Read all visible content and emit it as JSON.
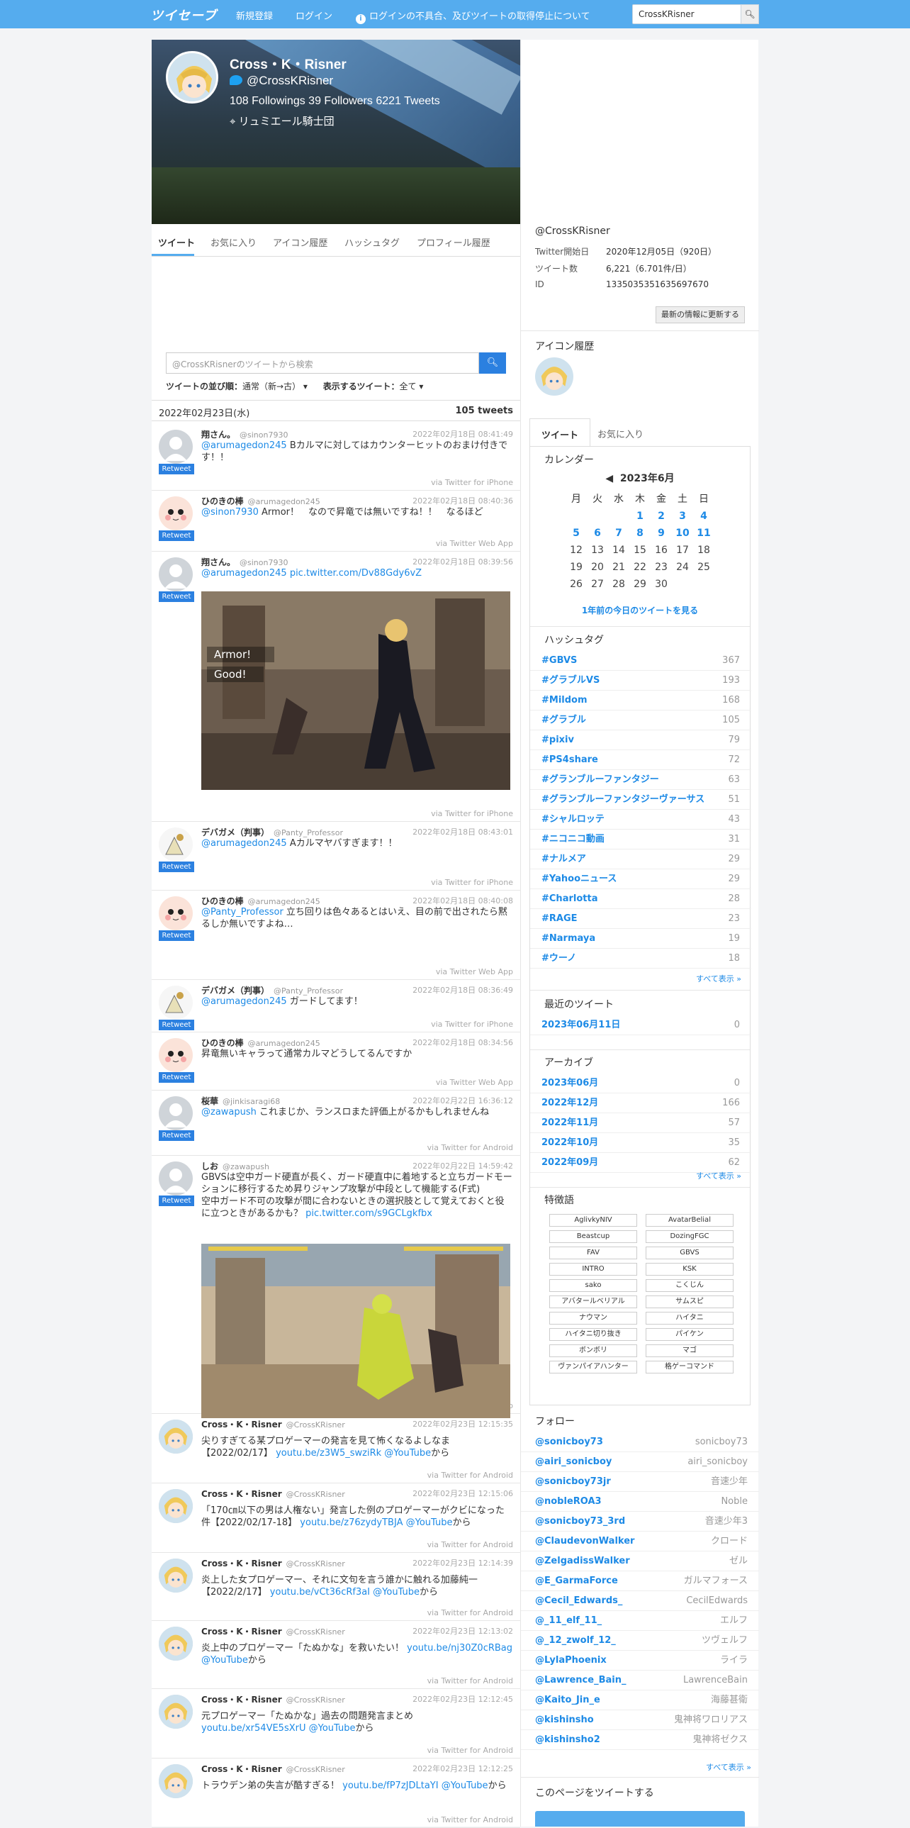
{
  "topbar": {
    "logo": "ツイセーブ",
    "signup": "新規登録",
    "login": "ログイン",
    "notice": "ログインの不具合、及びツイートの取得停止について",
    "search_value": "CrossKRisner"
  },
  "profile": {
    "name": "Cross・K・Risner",
    "handle": "@CrossKRisner",
    "stats": "108 Followings   39 Followers   6221 Tweets",
    "location": "リュミエール騎士団"
  },
  "tabs": [
    "ツイート",
    "お気に入り",
    "アイコン履歴",
    "ハッシュタグ",
    "プロフィール履歴"
  ],
  "tweet_search": {
    "placeholder": "@CrossKRisnerのツイートから検索",
    "sort_label": "ツイートの並び順：",
    "sort_value": "通常（新→古）",
    "show_label": "表示するツイート：",
    "show_value": "全て"
  },
  "date_header": {
    "date": "2022年02月23日(水)",
    "count": "105 tweets"
  },
  "retweet_label": "Retweet",
  "tweets": [
    {
      "name": "翔さん。",
      "screen": "@sinon7930",
      "date": "2022年02月18日 08:41:49",
      "text_link": "@arumagedon245",
      "text": " Bカルマに対してはカウンターヒットのおまけ付きです！！",
      "via": "via Twitter for iPhone"
    },
    {
      "name": "ひのきの棒",
      "screen": "@arumagedon245",
      "date": "2022年02月18日 08:40:36",
      "text_link": "@sinon7930",
      "text": " Armor！　なので昇竜では無いですね！！　なるほど",
      "via": "via Twitter Web App"
    },
    {
      "name": "翔さん。",
      "screen": "@sinon7930",
      "date": "2022年02月18日 08:39:56",
      "text_link": "@arumagedon245 pic.twitter.com/Dv88Gdy6vZ",
      "text": "",
      "via": "via Twitter for iPhone"
    },
    {
      "name": "デバガメ（判事）",
      "screen": "@Panty_Professor",
      "date": "2022年02月18日 08:43:01",
      "text_link": "@arumagedon245",
      "text": " Aカルマヤバすぎます！！",
      "via": "via Twitter for iPhone"
    },
    {
      "name": "ひのきの棒",
      "screen": "@arumagedon245",
      "date": "2022年02月18日 08:40:08",
      "text_link": "@Panty_Professor",
      "text": " 立ち回りは色々あるとはいえ、目の前で出されたら黙るしか無いですよね…",
      "via": "via Twitter Web App"
    },
    {
      "name": "デバガメ（判事）",
      "screen": "@Panty_Professor",
      "date": "2022年02月18日 08:36:49",
      "text_link": "@arumagedon245",
      "text": " ガードしてます！",
      "via": "via Twitter for iPhone"
    },
    {
      "name": "ひのきの棒",
      "screen": "@arumagedon245",
      "date": "2022年02月18日 08:34:56",
      "text_link": "",
      "text": "昇竜無いキャラって通常カルマどうしてるんですか",
      "via": "via Twitter Web App"
    },
    {
      "name": "桜華",
      "screen": "@jinkisaragi68",
      "date": "2022年02月22日 16:36:12",
      "text_link": "@zawapush",
      "text": " これまじか、ランスロまた評価上がるかもしれませんね",
      "via": "via Twitter for Android"
    },
    {
      "name": "しお",
      "screen": "@zawapush",
      "date": "2022年02月22日 14:59:42",
      "text_link": "",
      "text": "GBVSは空中ガード硬直が長く、ガード硬直中に着地すると立ちガードモーションに移行するため昇りジャンプ攻撃が中段として機能する(F式)\n空中ガード不可の攻撃が間に合わないときの選択肢として覚えておくと役に立つときがあるかも？ ",
      "text_tail_link": "pic.twitter.com/s9GCLgkfbx",
      "via": "via Twitter Web App"
    },
    {
      "name": "Cross・K・Risner",
      "screen": "@CrossKRisner",
      "date": "2022年02月23日 12:15:35",
      "text_link": "",
      "text": "尖りすぎてる某プロゲーマーの発言を見て怖くなるよしなま【2022/02/17】 ",
      "text_tail_link": "youtu.be/z3W5_swziRk @YouTube",
      "text_tail": "から",
      "via": "via Twitter for Android"
    },
    {
      "name": "Cross・K・Risner",
      "screen": "@CrossKRisner",
      "date": "2022年02月23日 12:15:06",
      "text_link": "",
      "text": "「170㎝以下の男は人権ない」発言した例のプロゲーマーがクビになった件【2022/02/17-18】 ",
      "text_tail_link": "youtu.be/z76zydyTBJA @YouTube",
      "text_tail": "から",
      "via": "via Twitter for Android"
    },
    {
      "name": "Cross・K・Risner",
      "screen": "@CrossKRisner",
      "date": "2022年02月23日 12:14:39",
      "text_link": "",
      "text": "炎上した女プロゲーマー、それに文句を言う誰かに触れる加藤純一【2022/2/17】 ",
      "text_tail_link": "youtu.be/vCt36cRf3aI @YouTube",
      "text_tail": "から",
      "via": "via Twitter for Android"
    },
    {
      "name": "Cross・K・Risner",
      "screen": "@CrossKRisner",
      "date": "2022年02月23日 12:13:02",
      "text_link": "",
      "text": "炎上中のプロゲーマー「たぬかな」を救いたい！ ",
      "text_tail_link": "youtu.be/nj30Z0cRBag @YouTube",
      "text_tail": "から",
      "via": "via Twitter for Android"
    },
    {
      "name": "Cross・K・Risner",
      "screen": "@CrossKRisner",
      "date": "2022年02月23日 12:12:45",
      "text_link": "",
      "text": "元プロゲーマー「たぬかな」過去の問題発言まとめ ",
      "text_tail_link": "youtu.be/xr54VE5sXrU @YouTube",
      "text_tail": "から",
      "via": "via Twitter for Android"
    },
    {
      "name": "Cross・K・Risner",
      "screen": "@CrossKRisner",
      "date": "2022年02月23日 12:12:25",
      "text_link": "",
      "text": "トラウデン弟の失言が酷すぎる！ ",
      "text_tail_link": "youtu.be/fP7zJDLtaYI @YouTube",
      "text_tail": "から",
      "via": "via Twitter for Android"
    }
  ],
  "media1": {
    "caption1": "Armor!",
    "caption2": "Good!"
  },
  "sidebar": {
    "handle": "@CrossKRisner",
    "start_label": "Twitter開始日",
    "start_value": "2020年12月05日（920日）",
    "count_label": "ツイート数",
    "count_value": "6,221（6.701件/日）",
    "id_label": "ID",
    "id_value": "1335035351635697670",
    "refresh": "最新の情報に更新する",
    "icon_history": "アイコン履歴",
    "tab_tweet": "ツイート",
    "tab_fav": "お気に入り",
    "calendar_title": "カレンダー",
    "calendar_month": "2023年6月",
    "weekdays": [
      "月",
      "火",
      "水",
      "木",
      "金",
      "土",
      "日"
    ],
    "weeks": [
      [
        "",
        "",
        "",
        "1",
        "2",
        "3",
        "4"
      ],
      [
        "5",
        "6",
        "7",
        "8",
        "9",
        "10",
        "11"
      ],
      [
        "12",
        "13",
        "14",
        "15",
        "16",
        "17",
        "18"
      ],
      [
        "19",
        "20",
        "21",
        "22",
        "23",
        "24",
        "25"
      ],
      [
        "26",
        "27",
        "28",
        "29",
        "30",
        "",
        ""
      ]
    ],
    "year_ago": "1年前の今日のツイートを見る",
    "hashtag_title": "ハッシュタグ",
    "hashtags": [
      {
        "tag": "#GBVS",
        "count": "367"
      },
      {
        "tag": "#グラブルVS",
        "count": "193"
      },
      {
        "tag": "#Mildom",
        "count": "168"
      },
      {
        "tag": "#グラブル",
        "count": "105"
      },
      {
        "tag": "#pixiv",
        "count": "79"
      },
      {
        "tag": "#PS4share",
        "count": "72"
      },
      {
        "tag": "#グランブルーファンタジー",
        "count": "63"
      },
      {
        "tag": "#グランブルーファンタジーヴァーサス",
        "count": "51"
      },
      {
        "tag": "#シャルロッテ",
        "count": "43"
      },
      {
        "tag": "#ニコニコ動画",
        "count": "31"
      },
      {
        "tag": "#ナルメア",
        "count": "29"
      },
      {
        "tag": "#Yahooニュース",
        "count": "29"
      },
      {
        "tag": "#Charlotta",
        "count": "28"
      },
      {
        "tag": "#RAGE",
        "count": "23"
      },
      {
        "tag": "#Narmaya",
        "count": "19"
      },
      {
        "tag": "#ウーノ",
        "count": "18"
      }
    ],
    "show_all": "すべて表示 »",
    "recent_title": "最近のツイート",
    "recent": [
      {
        "tag": "2023年06月11日",
        "count": "0"
      }
    ],
    "archive_title": "アーカイブ",
    "archive": [
      {
        "tag": "2023年06月",
        "count": "0"
      },
      {
        "tag": "2022年12月",
        "count": "166"
      },
      {
        "tag": "2022年11月",
        "count": "57"
      },
      {
        "tag": "2022年10月",
        "count": "35"
      },
      {
        "tag": "2022年09月",
        "count": "62"
      }
    ],
    "words_title": "特徴語",
    "words": [
      "AglivkyNIV",
      "AvatarBelial",
      "Beastcup",
      "DozingFGC",
      "FAV",
      "GBVS",
      "INTRO",
      "KSK",
      "sako",
      "こくじん",
      "アバタールベリアル",
      "サムスピ",
      "ナウマン",
      "ハイタニ",
      "ハイタニ切り抜き",
      "パイケン",
      "ボンボリ",
      "マゴ",
      "ヴァンパイアハンター",
      "格ゲーコマンド"
    ],
    "follow_title": "フォロー",
    "follows": [
      {
        "tag": "@sonicboy73",
        "count": "sonicboy73"
      },
      {
        "tag": "@airi_sonicboy",
        "count": "airi_sonicboy"
      },
      {
        "tag": "@sonicboy73jr",
        "count": "音速少年"
      },
      {
        "tag": "@nobleROA3",
        "count": "Noble"
      },
      {
        "tag": "@sonicboy73_3rd",
        "count": "音速少年3"
      },
      {
        "tag": "@ClaudevonWalker",
        "count": "クロード"
      },
      {
        "tag": "@ZelgadissWalker",
        "count": "ゼル"
      },
      {
        "tag": "@E_GarmaForce",
        "count": "ガルマフォース"
      },
      {
        "tag": "@Cecil_Edwards_",
        "count": "CecilEdwards"
      },
      {
        "tag": "@_11_elf_11_",
        "count": "エルフ"
      },
      {
        "tag": "@_12_zwolf_12_",
        "count": "ツヴェルフ"
      },
      {
        "tag": "@LylaPhoenix",
        "count": "ライラ"
      },
      {
        "tag": "@Lawrence_Bain_",
        "count": "LawrenceBain"
      },
      {
        "tag": "@Kaito_Jin_e",
        "count": "海藤甚衛"
      },
      {
        "tag": "@kishinsho",
        "count": "鬼神将ワロリアス"
      },
      {
        "tag": "@kishinsho2",
        "count": "鬼神将ゼクス"
      }
    ],
    "share_title": "このページをツイートする"
  }
}
